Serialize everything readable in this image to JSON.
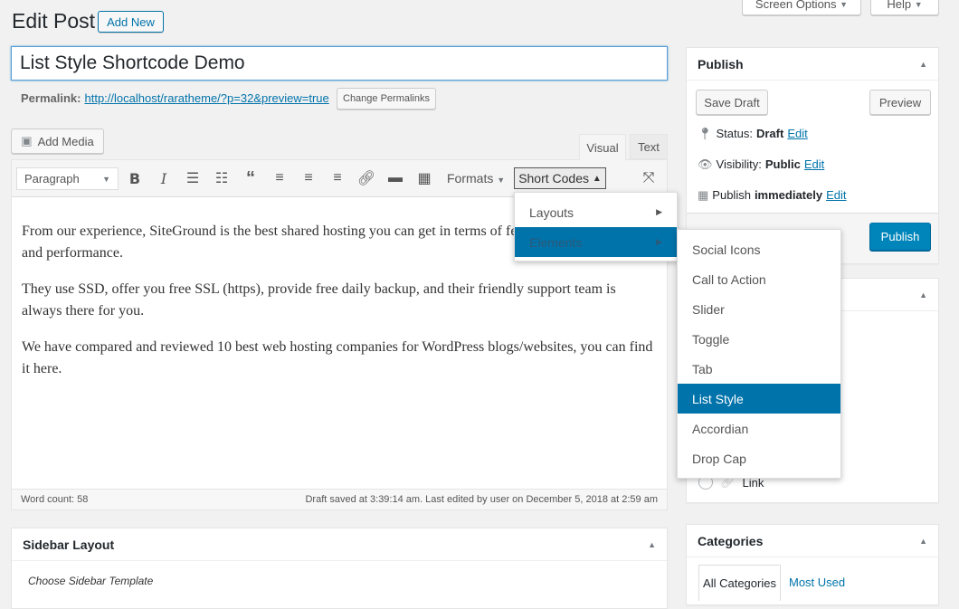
{
  "header": {
    "title": "Edit Post",
    "add_new": "Add New",
    "screen_options": "Screen Options",
    "help": "Help"
  },
  "post": {
    "title": "List Style Shortcode Demo",
    "permalink_label": "Permalink:",
    "permalink_url": "http://localhost/raratheme/?p=32&preview=true",
    "change_permalinks": "Change Permalinks"
  },
  "editor": {
    "add_media": "Add Media",
    "tab_visual": "Visual",
    "tab_text": "Text",
    "format_select": "Paragraph",
    "formats": "Formats",
    "short_codes": "Short Codes",
    "paragraphs": [
      "From our experience, SiteGround is the best shared hosting you can get in terms of features, affordability, and performance.",
      "They use SSD, offer you free SSL (https), provide free daily backup, and their friendly support team is always there for you.",
      "We have compared and reviewed 10 best web hosting companies for WordPress blogs/websites, you can find it here."
    ],
    "word_count": "Word count: 58",
    "status": "Draft saved at 3:39:14 am. Last edited by user on December 5, 2018 at 2:59 am"
  },
  "shortcodes_menu": {
    "items": [
      "Layouts",
      "Elements"
    ],
    "submenu": [
      "Social Icons",
      "Call to Action",
      "Slider",
      "Toggle",
      "Tab",
      "List Style",
      "Accordian",
      "Drop Cap"
    ],
    "selected": "List Style"
  },
  "publish": {
    "title": "Publish",
    "save_draft": "Save Draft",
    "preview": "Preview",
    "status_label": "Status:",
    "status": "Draft",
    "visibility_label": "Visibility:",
    "visibility": "Public",
    "publish_label": "Publish",
    "publish_when": "immediately",
    "edit": "Edit",
    "publish_button": "Publish"
  },
  "format_box": {
    "link": "Link"
  },
  "categories": {
    "title": "Categories",
    "tab_all": "All Categories",
    "tab_most": "Most Used"
  },
  "sidebar_layout": {
    "title": "Sidebar Layout",
    "choose": "Choose Sidebar Template"
  },
  "colors": {
    "accent": "#0073aa"
  }
}
